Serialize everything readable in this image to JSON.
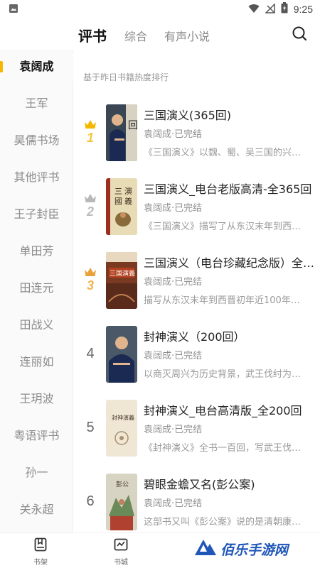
{
  "status_bar": {
    "time": "9:25"
  },
  "header": {
    "tabs": [
      {
        "label": "评书",
        "active": true
      },
      {
        "label": "综合",
        "active": false
      },
      {
        "label": "有声小说",
        "active": false
      }
    ]
  },
  "sidebar": {
    "items": [
      {
        "label": "袁阔成",
        "active": true
      },
      {
        "label": "王军"
      },
      {
        "label": "昊儒书场"
      },
      {
        "label": "其他评书"
      },
      {
        "label": "王子封臣"
      },
      {
        "label": "单田芳"
      },
      {
        "label": "田连元"
      },
      {
        "label": "田战义"
      },
      {
        "label": "连丽如"
      },
      {
        "label": "王玥波"
      },
      {
        "label": "粤语评书"
      },
      {
        "label": "孙一"
      },
      {
        "label": "关永超"
      }
    ]
  },
  "content": {
    "subtitle": "基于昨日书籍热度排行",
    "books": [
      {
        "rank": "1",
        "medal": "gold",
        "title": "三国演义(365回)",
        "author": "袁阔成·已完结",
        "desc": "《三国演义》以魏、蜀、吴三国的兴…"
      },
      {
        "rank": "2",
        "medal": "silver",
        "title": "三国演义_电台老版高清-全365回",
        "author": "袁阔成·已完结",
        "desc": "《三国演义》描写了从东汉末年到西…"
      },
      {
        "rank": "3",
        "medal": "bronze",
        "title": "三国演义（电台珍藏纪念版）全…",
        "author": "袁阔成·已完结",
        "desc": "描写从东汉末年到西晋初年近100年…"
      },
      {
        "rank": "4",
        "medal": "",
        "title": "封神演义（200回）",
        "author": "袁阔成·已完结",
        "desc": "以商灭周兴为历史背景，武王伐纣为…"
      },
      {
        "rank": "5",
        "medal": "",
        "title": "封神演义_电台高清版_全200回",
        "author": "袁阔成·已完结",
        "desc": "《封神演义》全书一百回，写武王伐…"
      },
      {
        "rank": "6",
        "medal": "",
        "title": "碧眼金蟾又名(彭公案)",
        "author": "袁阔成·已完结",
        "desc": "这部书又叫《彭公案》说的是清朝康…"
      }
    ]
  },
  "bottom_nav": {
    "items": [
      {
        "label": "书架",
        "icon": "bookshelf-icon"
      },
      {
        "label": "书城",
        "icon": "bookstore-icon"
      }
    ]
  },
  "watermark": {
    "text": "佰乐手游网"
  },
  "colors": {
    "accent": "#f5b800",
    "gold": "#f5b800",
    "silver": "#b8b8b8",
    "bronze": "#e8a23a",
    "brand_blue": "#1f56b8"
  }
}
